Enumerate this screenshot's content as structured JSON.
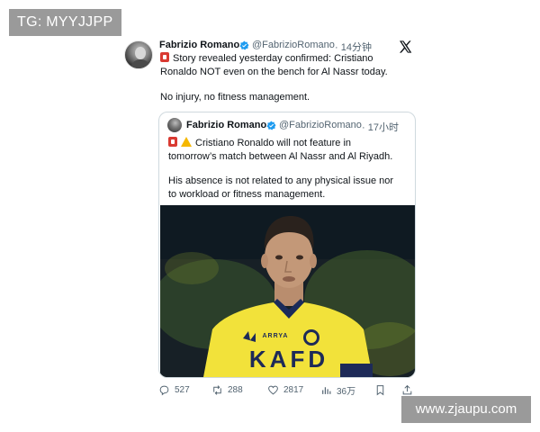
{
  "watermark_top": "TG: MYYJJPP",
  "watermark_bottom": "www.zjaupu.com",
  "tweet": {
    "author_name": "Fabrizio Romano",
    "author_handle": "@FabrizioRomano",
    "time": "· 14分钟",
    "lines": [
      "Story revealed yesterday confirmed: Cristiano",
      "Ronaldo NOT even on the bench for Al Nassr today."
    ],
    "line3": "No injury, no fitness management.",
    "icons": [
      "red-card-emoji-icon",
      "x-logo-icon",
      "verified-badge-icon"
    ]
  },
  "quoted": {
    "author_name": "Fabrizio Romano",
    "author_handle": "@FabrizioRomano",
    "time": "· 17小时",
    "lines": [
      "Cristiano Ronaldo will not feature in",
      "tomorrow’s match between Al Nassr and Al Riyadh."
    ],
    "lines2": [
      "His absence is not related to any physical issue nor",
      "to workload or fitness management."
    ],
    "photo": {
      "shirt_sponsor": "KAFD",
      "shirt_brand": "ARRYA",
      "description_icon": "player-photo"
    }
  },
  "actions": {
    "reply_count": "527",
    "retweet_count": "288",
    "like_count": "2817",
    "views_count": "36万"
  },
  "colors": {
    "text": "#0f1419",
    "muted": "#536471",
    "verified": "#1d9bf0",
    "jersey": "#f2e23a",
    "border": "#cfd9de"
  }
}
